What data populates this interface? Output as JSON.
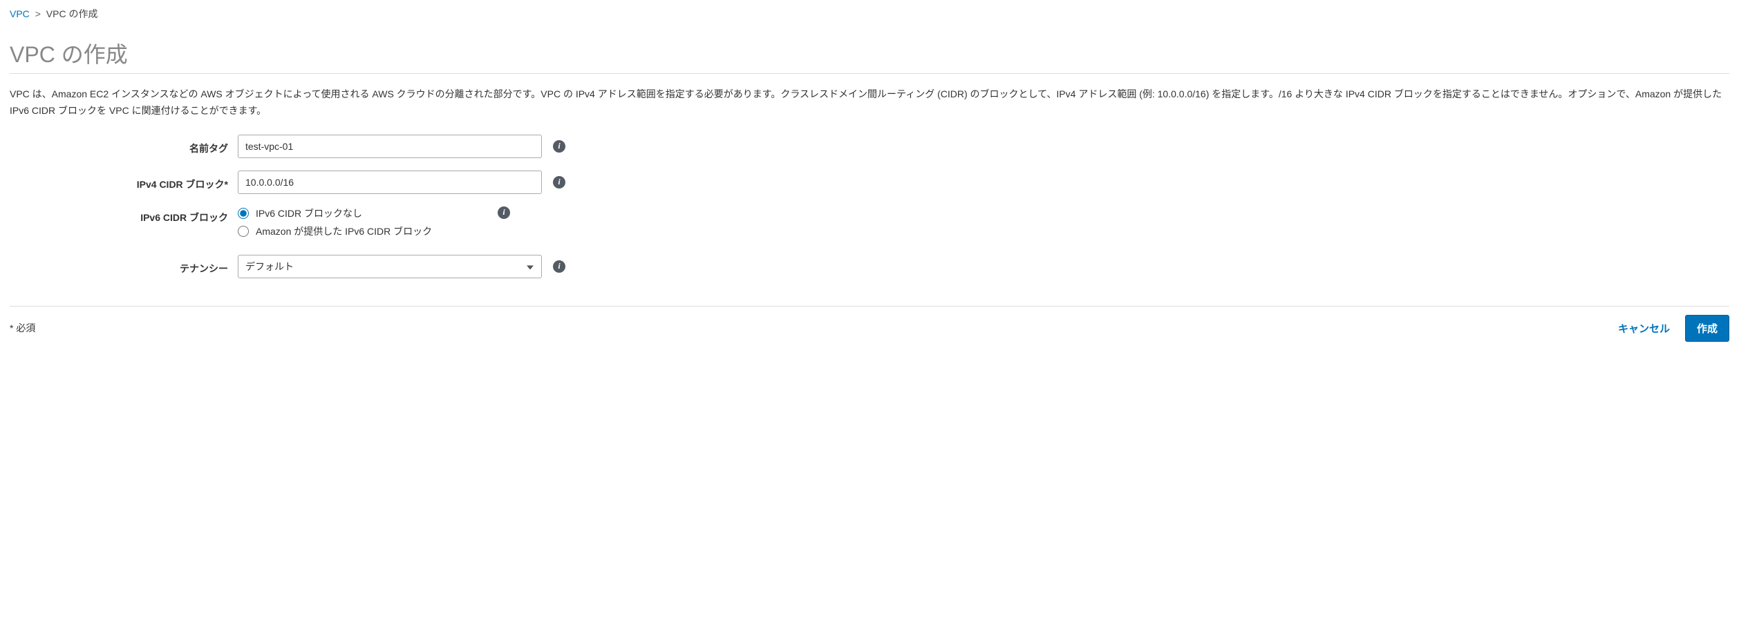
{
  "breadcrumb": {
    "root": "VPC",
    "current": "VPC の作成"
  },
  "page_title": "VPC の作成",
  "description": "VPC は、Amazon EC2 インスタンスなどの AWS オブジェクトによって使用される AWS クラウドの分離された部分です。VPC の IPv4 アドレス範囲を指定する必要があります。クラスレスドメイン間ルーティング (CIDR) のブロックとして、IPv4 アドレス範囲 (例: 10.0.0.0/16) を指定します。/16 より大きな IPv4 CIDR ブロックを指定することはできません。オプションで、Amazon が提供した IPv6 CIDR ブロックを VPC に関連付けることができます。",
  "form": {
    "name_tag": {
      "label": "名前タグ",
      "value": "test-vpc-01"
    },
    "ipv4_cidr": {
      "label": "IPv4 CIDR ブロック*",
      "value": "10.0.0.0/16"
    },
    "ipv6_cidr": {
      "label": "IPv6 CIDR ブロック",
      "option_none": "IPv6 CIDR ブロックなし",
      "option_amazon": "Amazon が提供した IPv6 CIDR ブロック",
      "selected": "none"
    },
    "tenancy": {
      "label": "テナンシー",
      "value": "デフォルト"
    }
  },
  "footer": {
    "required_note": "* 必須",
    "cancel": "キャンセル",
    "submit": "作成"
  },
  "icons": {
    "info": "i"
  }
}
